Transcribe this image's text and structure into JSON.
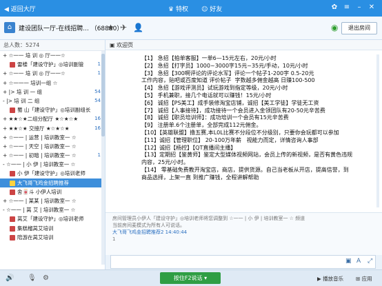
{
  "topbar": {
    "back": "返回大厅",
    "tab_privilege": "特权",
    "tab_friends": "好友"
  },
  "header": {
    "title": "建设团队一厅-在线招聘... （68880）",
    "exit": "退出房间"
  },
  "sidebar": {
    "count_label": "总人数：5274",
    "rows": [
      {
        "text": "+ ☆一一 培 训 ◎ 厅一一☆",
        "num": "",
        "type": "group"
      },
      {
        "text": "雷楼「建设守护」◎培训副管",
        "num": "1",
        "type": "user"
      },
      {
        "text": "+ ☆一一 培 训 ◎ 厅一一☆",
        "num": "1",
        "type": "group"
      },
      {
        "text": "+ ☆一一一 培训一组 ☆",
        "num": "",
        "type": "group"
      },
      {
        "text": "+ |>  培  训  一  组",
        "num": "54",
        "type": "group"
      },
      {
        "text": "- |>  培  训  二  组",
        "num": "54",
        "type": "group"
      },
      {
        "text": "蜀 山「建设守护」◎培训副组长",
        "num": "",
        "type": "user"
      },
      {
        "text": "+ ★★☆★二组分配厅 ★☆★☆★",
        "num": "16",
        "type": "group"
      },
      {
        "text": "+ ★★☆★ 交接厅 ★☆★☆★",
        "num": "16",
        "type": "group"
      },
      {
        "text": "+ ☆一一 | 运营 | 培训教室一 ☆",
        "num": "",
        "type": "group"
      },
      {
        "text": "+ ☆一一 | 天空 | 培训教室一 ☆",
        "num": "",
        "type": "group"
      },
      {
        "text": "+ ☆一一 | 初暗 | 培训教室一 ☆",
        "num": "1",
        "type": "group"
      },
      {
        "text": "- ☆一一 | 小 伊 | 培训教室一 ☆",
        "num": "",
        "type": "group"
      },
      {
        "text": "小 伊「建设守护」◎培训老师",
        "num": "",
        "type": "user"
      },
      {
        "text": "大飞哥飞鸡金招聘推荐",
        "num": "",
        "type": "selected"
      },
      {
        "text": "舍🀄斗 小伊人培训",
        "num": "",
        "type": "user"
      },
      {
        "text": "+ ☆一一 | 某某 | 培训教室一 ☆",
        "num": "",
        "type": "group"
      },
      {
        "text": "- ☆一一 | 莴 艾 | 培训教室一 ☆",
        "num": "",
        "type": "group"
      },
      {
        "text": "莴艾「建设守护」◎培训老师",
        "num": "",
        "type": "user"
      },
      {
        "text": "集糕榴莴艾培训",
        "num": "",
        "type": "user"
      },
      {
        "text": "陪游在莴艾培训",
        "num": "",
        "type": "user"
      }
    ]
  },
  "tabline": {
    "label": "欢迎页"
  },
  "notice": {
    "lines": [
      "【1】 急招【拍单客服】一单6—15元左右，20元/小时",
      "【2】 急招【打字员】1000~3000字15元~35元/手动，10元/小时",
      "【3】 急招【300啊评论的评论水军】评论一个帖子1-200字 0.5-20元",
      "工作内容，贴吧或百度知道 评价帖子  字数越多佣金越高 日赚100-500",
      "【4】 急招【游戏评测员】试玩游戏到指定等级，20元/小时",
      "【5】 手机兼职，接几个电话就可以赚钱！15元/小时",
      "【6】 诚招【PS美工】成手装修淘宝店铺，诚招【美工学徒】学徒无工资",
      "【7】 诚招【人事接待】，成功接待一个会员进入金领团队有20-50元辛苦费",
      "【8】 诚招【职员培训师】：成功培训一个会员有15元辛苦费",
      "【9】 注册单.6个注册单，全部完成112元佣金。",
      "【10】【英雄联盟】撸五赛,本L0L比赛不分段位不分级别，只要你会玩都可以参加",
      "【11】诚招【管理职位】 20-100万年薪   视能力而定，详情咨询人事部",
      "【12】诚招【杨控】【QT直播间主播】",
      "【13】定期招【鉴黄师】鉴定大型媒体视频网站，会员上传的新视频，是否有黄色违规",
      "内容，25元/小时。",
      "【14】 零基础免费教开淘宝店，商店，提供货源。自己当老板从开店，提高信誉，到",
      "商品选择，上架一直 到推广赚钱，全程讲解帮助"
    ]
  },
  "messages": [
    {
      "text": "房间管理员小伊人「建设守护」◎培训老师将您调整到  ☆一一 | 小 伊 | 培训教室一 ☆ 频道",
      "you": false
    },
    {
      "text": "当前房间麦模式为所有人可说话。",
      "you": false
    },
    {
      "text": "大飞哥飞鸡金招聘推荐2 14:40:44",
      "you": true
    },
    {
      "text": "1",
      "you": false
    }
  ],
  "input": {
    "value": ""
  },
  "bottom": {
    "talk": "按住F2说话",
    "play_music": "播放音乐",
    "app": "应用"
  }
}
